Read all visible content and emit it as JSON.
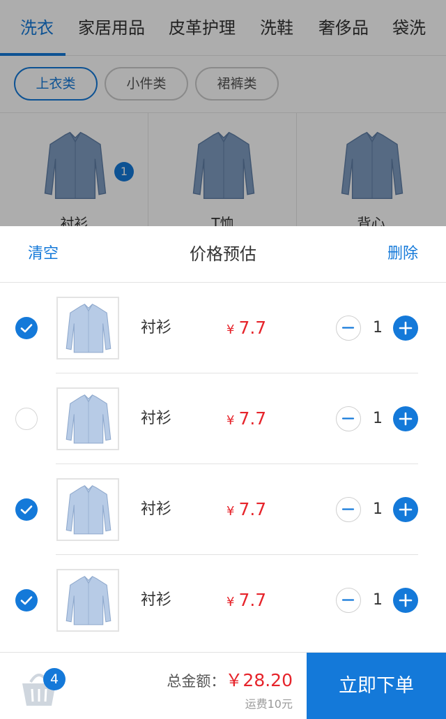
{
  "category_tabs": [
    "洗衣",
    "家居用品",
    "皮革护理",
    "洗鞋",
    "奢侈品",
    "袋洗"
  ],
  "sub_tabs": [
    "上衣类",
    "小件类",
    "裙裤类"
  ],
  "grid_items": [
    "衬衫",
    "T恤",
    "背心"
  ],
  "grid_badge": "1",
  "sheet": {
    "clear": "清空",
    "title": "价格预估",
    "delete": "删除"
  },
  "cart_items": [
    {
      "name": "衬衫",
      "currency": "¥",
      "price": "7.7",
      "qty": "1",
      "checked": true
    },
    {
      "name": "衬衫",
      "currency": "¥",
      "price": "7.7",
      "qty": "1",
      "checked": false
    },
    {
      "name": "衬衫",
      "currency": "¥",
      "price": "7.7",
      "qty": "1",
      "checked": true
    },
    {
      "name": "衬衫",
      "currency": "¥",
      "price": "7.7",
      "qty": "1",
      "checked": true
    }
  ],
  "footer": {
    "cart_count": "4",
    "total_label": "总金额：",
    "total_amount": "￥28.20",
    "shipping": "运费10元",
    "submit": "立即下单"
  },
  "colors": {
    "accent": "#1479d9",
    "price": "#e6242b",
    "shirt": "#7f9cc1"
  }
}
